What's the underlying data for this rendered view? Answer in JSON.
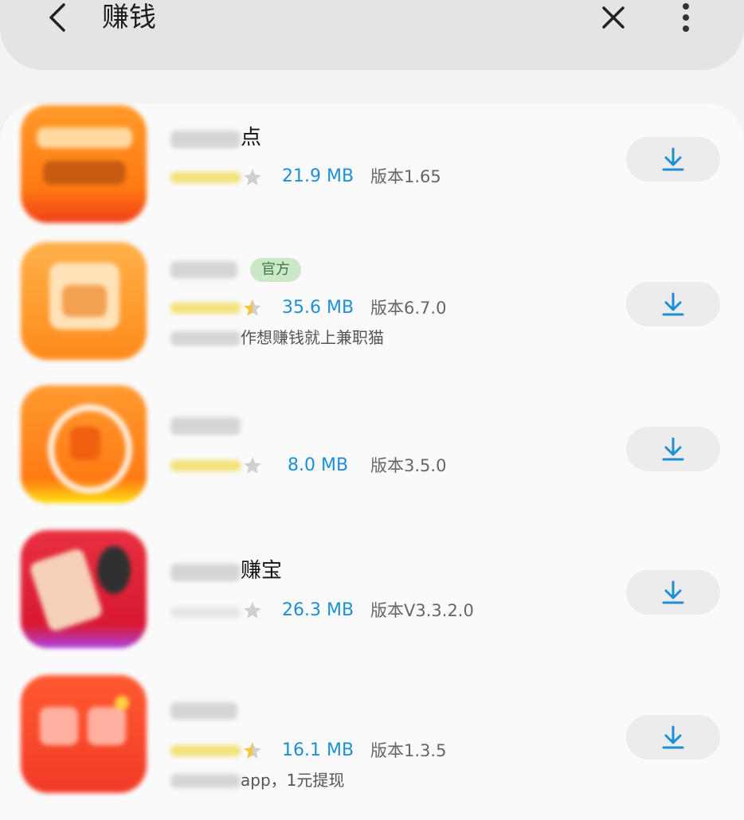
{
  "search": {
    "query": "赚钱",
    "icons": {
      "back": "back-arrow-icon",
      "clear": "close-icon",
      "more": "more-vert-icon"
    }
  },
  "colors": {
    "accent": "#1d8fd6",
    "badge_bg": "#cde8c8",
    "badge_text": "#3a7a3a"
  },
  "apps": [
    {
      "name_visible": "点",
      "badge": "",
      "rating_stars": 4,
      "size": "21.9 MB",
      "version": "版本1.65",
      "description_visible": ""
    },
    {
      "name_visible": "",
      "badge": "官方",
      "rating_stars": 4.5,
      "size": "35.6 MB",
      "version": "版本6.7.0",
      "description_visible": "作想赚钱就上兼职猫"
    },
    {
      "name_visible": "",
      "badge": "",
      "rating_stars": 4,
      "size": "8.0 MB",
      "version": "版本3.5.0",
      "description_visible": ""
    },
    {
      "name_visible": "赚宝",
      "badge": "",
      "rating_stars": 0,
      "size": "26.3 MB",
      "version": "版本V3.3.2.0",
      "description_visible": ""
    },
    {
      "name_visible": "",
      "badge": "",
      "rating_stars": 4.5,
      "size": "16.1 MB",
      "version": "版本1.3.5",
      "description_visible": "app，1元提现"
    }
  ]
}
